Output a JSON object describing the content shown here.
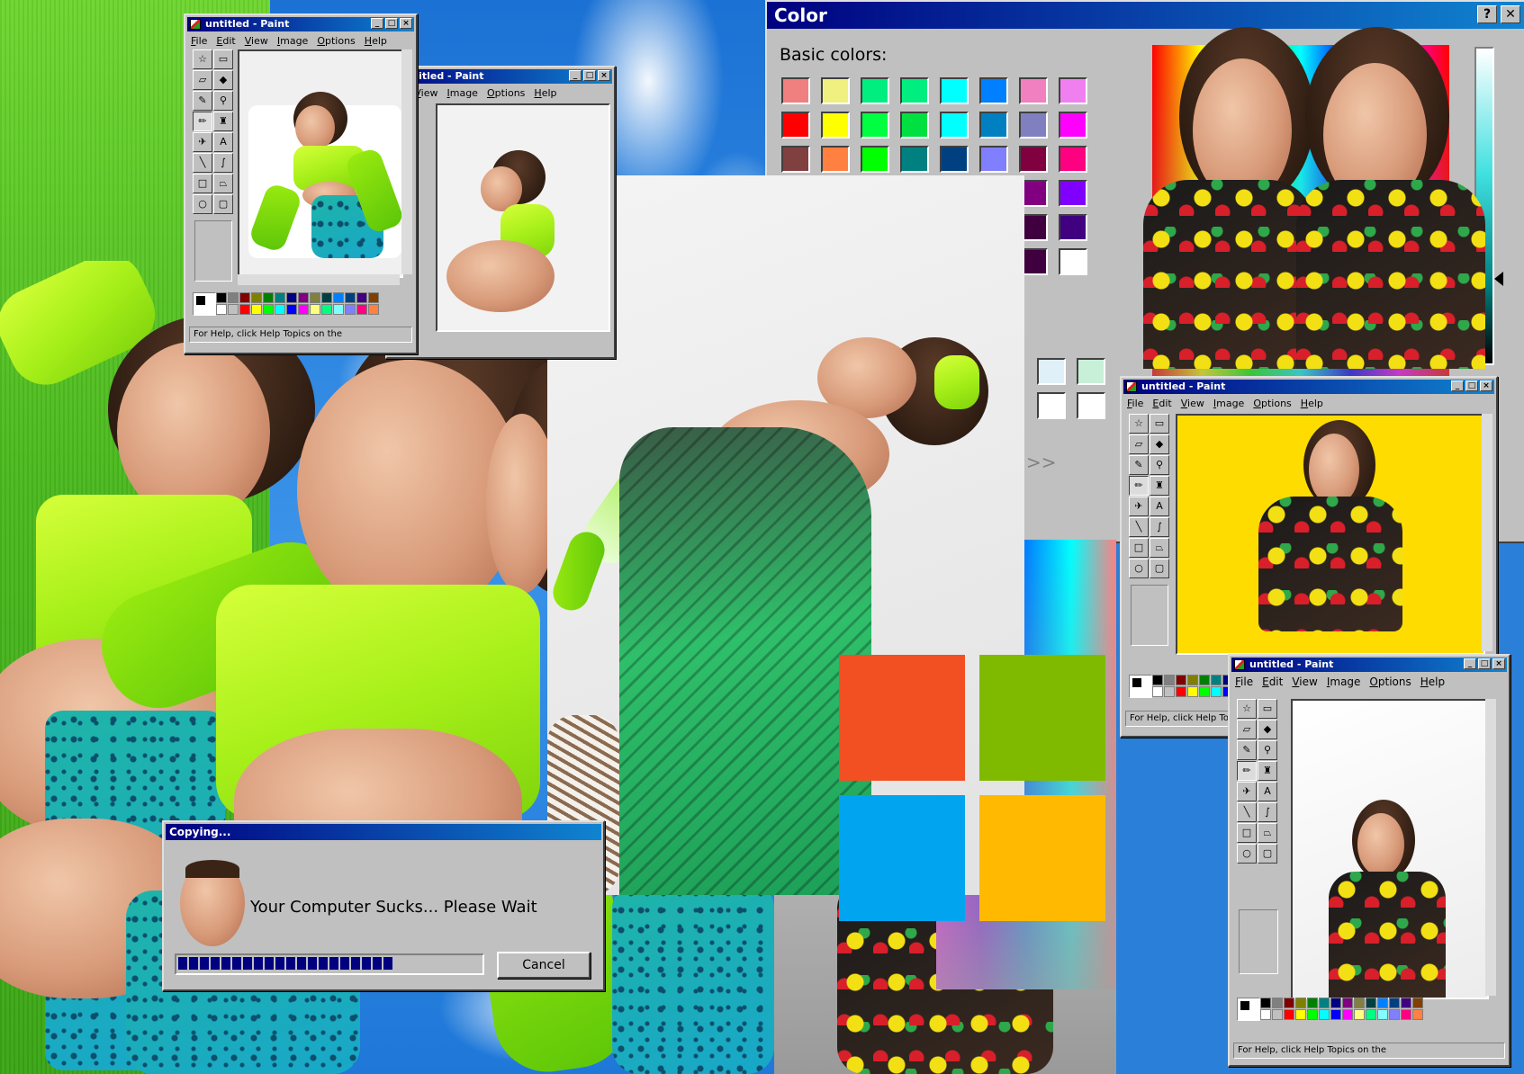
{
  "paint_window_1": {
    "title": "untitled - Paint",
    "menus": [
      "File",
      "Edit",
      "View",
      "Image",
      "Options",
      "Help"
    ],
    "status": "For Help, click Help Topics on the"
  },
  "paint_window_2": {
    "title": "ntitled - Paint",
    "menus": [
      "dit",
      "View",
      "Image",
      "Options",
      "Help"
    ]
  },
  "paint_window_3": {
    "title": "untitled - Paint",
    "menus": [
      "File",
      "Edit",
      "View",
      "Image",
      "Options",
      "Help"
    ],
    "status": "For Help, click Help To"
  },
  "paint_window_4": {
    "title": "untitled - Paint",
    "menus": [
      "File",
      "Edit",
      "View",
      "Image",
      "Options",
      "Help"
    ],
    "status": "For Help, click Help Topics on the"
  },
  "color_dialog": {
    "title": "Color",
    "help_button": "?",
    "close_button": "✕",
    "basic_colors_label": "Basic colors:",
    "more_label": ">>",
    "basic_colors": [
      "#f08080",
      "#f0f080",
      "#00ee80",
      "#00ee80",
      "#00ffff",
      "#0080ff",
      "#f080c0",
      "#f080f0",
      "#ff0000",
      "#ffff00",
      "#00ff40",
      "#00e040",
      "#00ffff",
      "#0080c0",
      "#8080c0",
      "#ff00ff",
      "#804040",
      "#ff8040",
      "#00ff00",
      "#008080",
      "#004080",
      "#8080ff",
      "#800040",
      "#ff0080",
      "#800000",
      "#ff8000",
      "#008000",
      "#008040",
      "#0000ff",
      "#0000a0",
      "#800080",
      "#8000ff",
      "#400000",
      "#804000",
      "#004000",
      "#004040",
      "#000080",
      "#000040",
      "#400040",
      "#400080",
      "#000000",
      "#808000",
      "#808040",
      "#808080",
      "#408080",
      "#c0c0c0",
      "#400040",
      "#ffffff"
    ],
    "custom_colors": [
      "#dff0f8",
      "#c8f0d8",
      "#ffffff",
      "#ffffff"
    ]
  },
  "copy_dialog": {
    "title": "Copying...",
    "message": "Your Computer Sucks... Please Wait",
    "cancel_label": "Cancel",
    "progress_fraction": 0.72
  },
  "windows_logo": {
    "colors": [
      "#f25022",
      "#7fba00",
      "#00a4ef",
      "#ffb900"
    ]
  },
  "palette_colors": [
    "#000000",
    "#ffffff",
    "#808080",
    "#c0c0c0",
    "#800000",
    "#ff0000",
    "#808000",
    "#ffff00",
    "#008000",
    "#00ff00",
    "#008080",
    "#00ffff",
    "#000080",
    "#0000ff",
    "#800080",
    "#ff00ff",
    "#808040",
    "#ffff80",
    "#004040",
    "#00ff80",
    "#0080ff",
    "#80ffff",
    "#004080",
    "#8080ff",
    "#400080",
    "#ff0080",
    "#804000",
    "#ff8040"
  ],
  "tool_icons": [
    "free-select",
    "rect-select",
    "eraser",
    "fill",
    "picker",
    "magnifier",
    "pencil",
    "brush",
    "airbrush",
    "text",
    "line",
    "curve",
    "rectangle",
    "polygon",
    "ellipse",
    "rounded-rect"
  ]
}
